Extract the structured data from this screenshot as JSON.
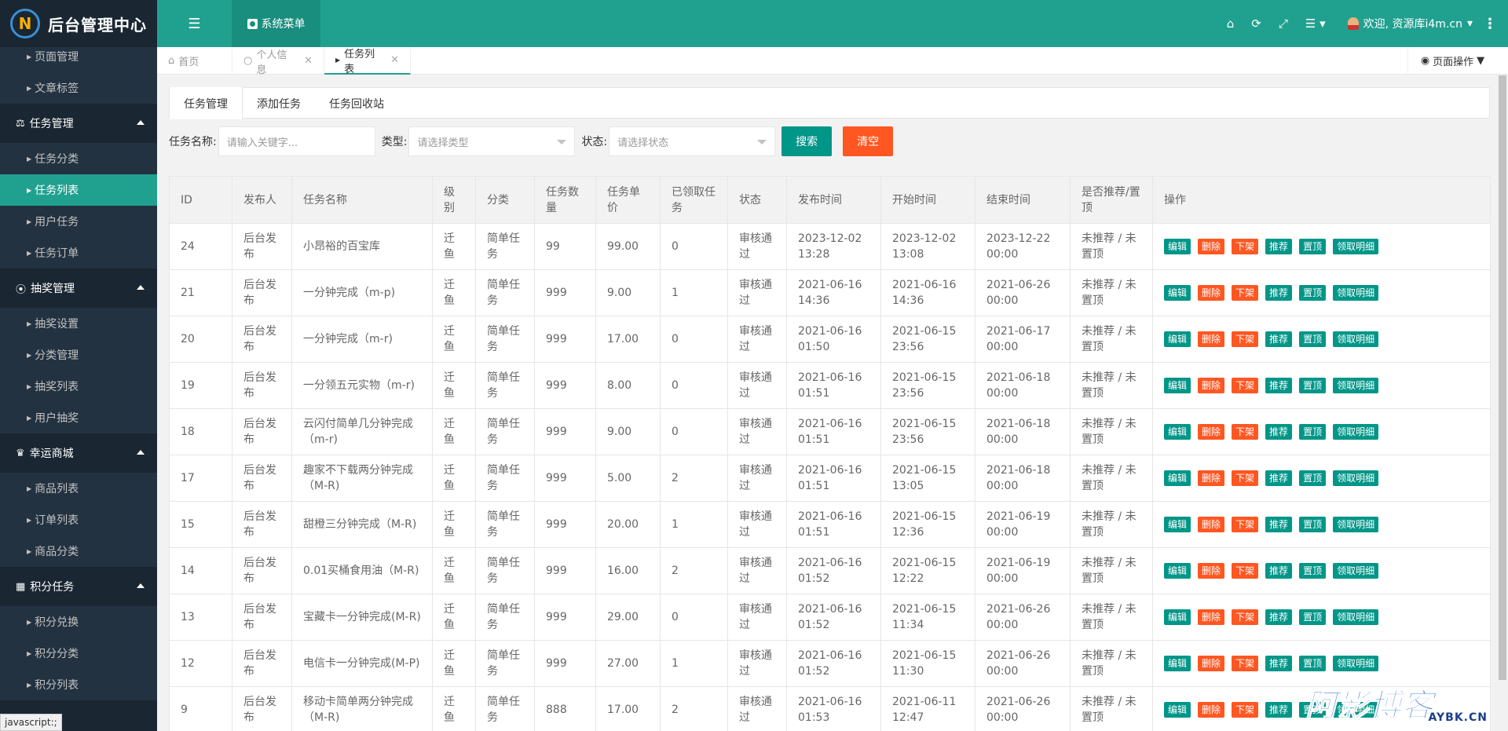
{
  "header": {
    "app_title": "后台管理中心",
    "logo_letter": "N",
    "system_menu": "系统菜单",
    "welcome": "欢迎, 资源库i4m.cn"
  },
  "sidebar": {
    "top_items": [
      {
        "label": "页面管理"
      },
      {
        "label": "文章标签"
      }
    ],
    "groups": [
      {
        "label": "任务管理",
        "icon": "bank-icon",
        "items": [
          {
            "label": "任务分类",
            "active": false
          },
          {
            "label": "任务列表",
            "active": true
          },
          {
            "label": "用户任务",
            "active": false
          },
          {
            "label": "任务订单",
            "active": false
          }
        ]
      },
      {
        "label": "抽奖管理",
        "icon": "compass-icon",
        "items": [
          {
            "label": "抽奖设置"
          },
          {
            "label": "分类管理"
          },
          {
            "label": "抽奖列表"
          },
          {
            "label": "用户抽奖"
          }
        ]
      },
      {
        "label": "幸运商城",
        "icon": "trophy-icon",
        "items": [
          {
            "label": "商品列表"
          },
          {
            "label": "订单列表"
          },
          {
            "label": "商品分类"
          }
        ]
      },
      {
        "label": "积分任务",
        "icon": "grid-icon",
        "items": [
          {
            "label": "积分兑换"
          },
          {
            "label": "积分分类"
          },
          {
            "label": "积分列表"
          }
        ]
      }
    ],
    "status_text": "javascript:;"
  },
  "tabs": [
    {
      "label": "首页"
    },
    {
      "label": "个人信息"
    },
    {
      "label": "任务列表"
    }
  ],
  "page_ops": "页面操作",
  "sub_tabs": [
    "任务管理",
    "添加任务",
    "任务回收站"
  ],
  "search": {
    "name_label": "任务名称:",
    "name_placeholder": "请输入关键字...",
    "type_label": "类型:",
    "type_placeholder": "请选择类型",
    "status_label": "状态:",
    "status_placeholder": "请选择状态",
    "search_btn": "搜索",
    "clear_btn": "清空"
  },
  "table": {
    "headers": [
      "ID",
      "发布人",
      "任务名称",
      "级别",
      "分类",
      "任务数量",
      "任务单价",
      "已领取任务",
      "状态",
      "发布时间",
      "开始时间",
      "结束时间",
      "是否推荐/置顶",
      "操作"
    ],
    "action_labels": {
      "edit": "编辑",
      "delete": "删除",
      "offline": "下架",
      "recommend": "推荐",
      "top": "置顶",
      "detail": "领取明细"
    },
    "rows": [
      {
        "id": "24",
        "publisher": "后台发布",
        "name": "小昂裕的百宝库",
        "level": "迁鱼",
        "category": "简单任务",
        "qty": "99",
        "price": "99.00",
        "claimed": "0",
        "status": "审核通过",
        "pub": "2023-12-02 13:28",
        "start": "2023-12-02 13:08",
        "end": "2023-12-22 00:00",
        "rec": "未推荐 / 未置顶"
      },
      {
        "id": "21",
        "publisher": "后台发布",
        "name": "一分钟完成（m-p)",
        "level": "迁鱼",
        "category": "简单任务",
        "qty": "999",
        "price": "9.00",
        "claimed": "1",
        "status": "审核通过",
        "pub": "2021-06-16 14:36",
        "start": "2021-06-16 14:36",
        "end": "2021-06-26 00:00",
        "rec": "未推荐 / 未置顶"
      },
      {
        "id": "20",
        "publisher": "后台发布",
        "name": "一分钟完成（m-r)",
        "level": "迁鱼",
        "category": "简单任务",
        "qty": "999",
        "price": "17.00",
        "claimed": "0",
        "status": "审核通过",
        "pub": "2021-06-16 01:50",
        "start": "2021-06-15 23:56",
        "end": "2021-06-17 00:00",
        "rec": "未推荐 / 未置顶"
      },
      {
        "id": "19",
        "publisher": "后台发布",
        "name": "一分领五元实物（m-r)",
        "level": "迁鱼",
        "category": "简单任务",
        "qty": "999",
        "price": "8.00",
        "claimed": "0",
        "status": "审核通过",
        "pub": "2021-06-16 01:51",
        "start": "2021-06-15 23:56",
        "end": "2021-06-18 00:00",
        "rec": "未推荐 / 未置顶"
      },
      {
        "id": "18",
        "publisher": "后台发布",
        "name": "云闪付简单几分钟完成（m-r)",
        "level": "迁鱼",
        "category": "简单任务",
        "qty": "999",
        "price": "9.00",
        "claimed": "0",
        "status": "审核通过",
        "pub": "2021-06-16 01:51",
        "start": "2021-06-15 23:56",
        "end": "2021-06-18 00:00",
        "rec": "未推荐 / 未置顶"
      },
      {
        "id": "17",
        "publisher": "后台发布",
        "name": "趣家不下载两分钟完成（M-R)",
        "level": "迁鱼",
        "category": "简单任务",
        "qty": "999",
        "price": "5.00",
        "claimed": "2",
        "status": "审核通过",
        "pub": "2021-06-16 01:51",
        "start": "2021-06-15 13:05",
        "end": "2021-06-18 00:00",
        "rec": "未推荐 / 未置顶"
      },
      {
        "id": "15",
        "publisher": "后台发布",
        "name": "甜橙三分钟完成（M-R)",
        "level": "迁鱼",
        "category": "简单任务",
        "qty": "999",
        "price": "20.00",
        "claimed": "1",
        "status": "审核通过",
        "pub": "2021-06-16 01:51",
        "start": "2021-06-15 12:36",
        "end": "2021-06-19 00:00",
        "rec": "未推荐 / 未置顶"
      },
      {
        "id": "14",
        "publisher": "后台发布",
        "name": "0.01买桶食用油（M-R)",
        "level": "迁鱼",
        "category": "简单任务",
        "qty": "999",
        "price": "16.00",
        "claimed": "2",
        "status": "审核通过",
        "pub": "2021-06-16 01:52",
        "start": "2021-06-15 12:22",
        "end": "2021-06-19 00:00",
        "rec": "未推荐 / 未置顶"
      },
      {
        "id": "13",
        "publisher": "后台发布",
        "name": "宝藏卡一分钟完成(M-R)",
        "level": "迁鱼",
        "category": "简单任务",
        "qty": "999",
        "price": "29.00",
        "claimed": "0",
        "status": "审核通过",
        "pub": "2021-06-16 01:52",
        "start": "2021-06-15 11:34",
        "end": "2021-06-26 00:00",
        "rec": "未推荐 / 未置顶"
      },
      {
        "id": "12",
        "publisher": "后台发布",
        "name": "电信卡一分钟完成(M-P)",
        "level": "迁鱼",
        "category": "简单任务",
        "qty": "999",
        "price": "27.00",
        "claimed": "1",
        "status": "审核通过",
        "pub": "2021-06-16 01:52",
        "start": "2021-06-15 11:30",
        "end": "2021-06-26 00:00",
        "rec": "未推荐 / 未置顶"
      },
      {
        "id": "9",
        "publisher": "后台发布",
        "name": "移动卡简单两分钟完成（M-R)",
        "level": "迁鱼",
        "category": "简单任务",
        "qty": "888",
        "price": "17.00",
        "claimed": "2",
        "status": "审核通过",
        "pub": "2021-06-16 01:53",
        "start": "2021-06-11 12:47",
        "end": "2021-06-26 00:00",
        "rec": "未推荐 / 未置顶"
      }
    ]
  },
  "watermark": {
    "main": "阿影博客",
    "sub": "AYBK.CN"
  },
  "colors": {
    "primary": "#20a190",
    "sidebar": "#1a2733",
    "green_btn": "#009688",
    "red_btn": "#ff5722"
  }
}
